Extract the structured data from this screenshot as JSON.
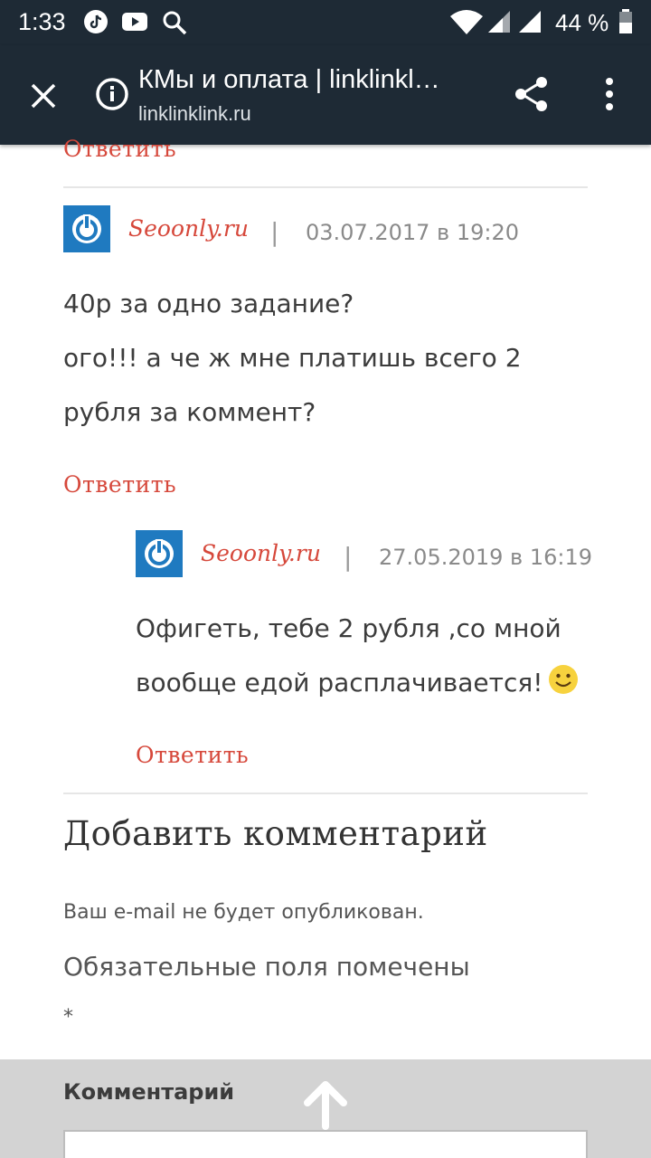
{
  "status_bar": {
    "time": "1:33",
    "battery": "44 %",
    "icons": [
      "tiktok-icon",
      "youtube-icon",
      "search-icon",
      "wifi-icon",
      "signal-icon",
      "signal-icon",
      "battery-icon"
    ]
  },
  "toolbar": {
    "title": "КМы и оплата | linklinkl…",
    "url": "linklinklink.ru",
    "icons": [
      "close-icon",
      "info-icon",
      "share-icon",
      "more-vert-icon"
    ]
  },
  "comments": {
    "top_reply": "Ответить",
    "comment1": {
      "author": "Seoonly.ru",
      "separator": "|",
      "date": "03.07.2017 в 19:20",
      "lines": [
        "40р за одно задание?",
        "ого!!! а че ж мне платишь всего 2",
        "рубля за коммент?"
      ],
      "reply": "Ответить"
    },
    "comment2": {
      "author": "Seoonly.ru",
      "separator": "|",
      "date": "27.05.2019 в 16:19",
      "lines": [
        "Офигеть, тебе 2 рубля ,со мной",
        "вообще едой расплачивается!"
      ],
      "reply": "Ответить"
    }
  },
  "add_comment": {
    "heading": "Добавить комментарий",
    "email_note": "Ваш e-mail не будет опубликован.",
    "required_note": "Обязательные поля помечены",
    "asterisk": "*",
    "comment_label": "Комментарий"
  },
  "colors": {
    "toolbar_bg": "#1e2a35",
    "accent_red": "#d6483b",
    "avatar_blue": "#1f7ac0"
  }
}
